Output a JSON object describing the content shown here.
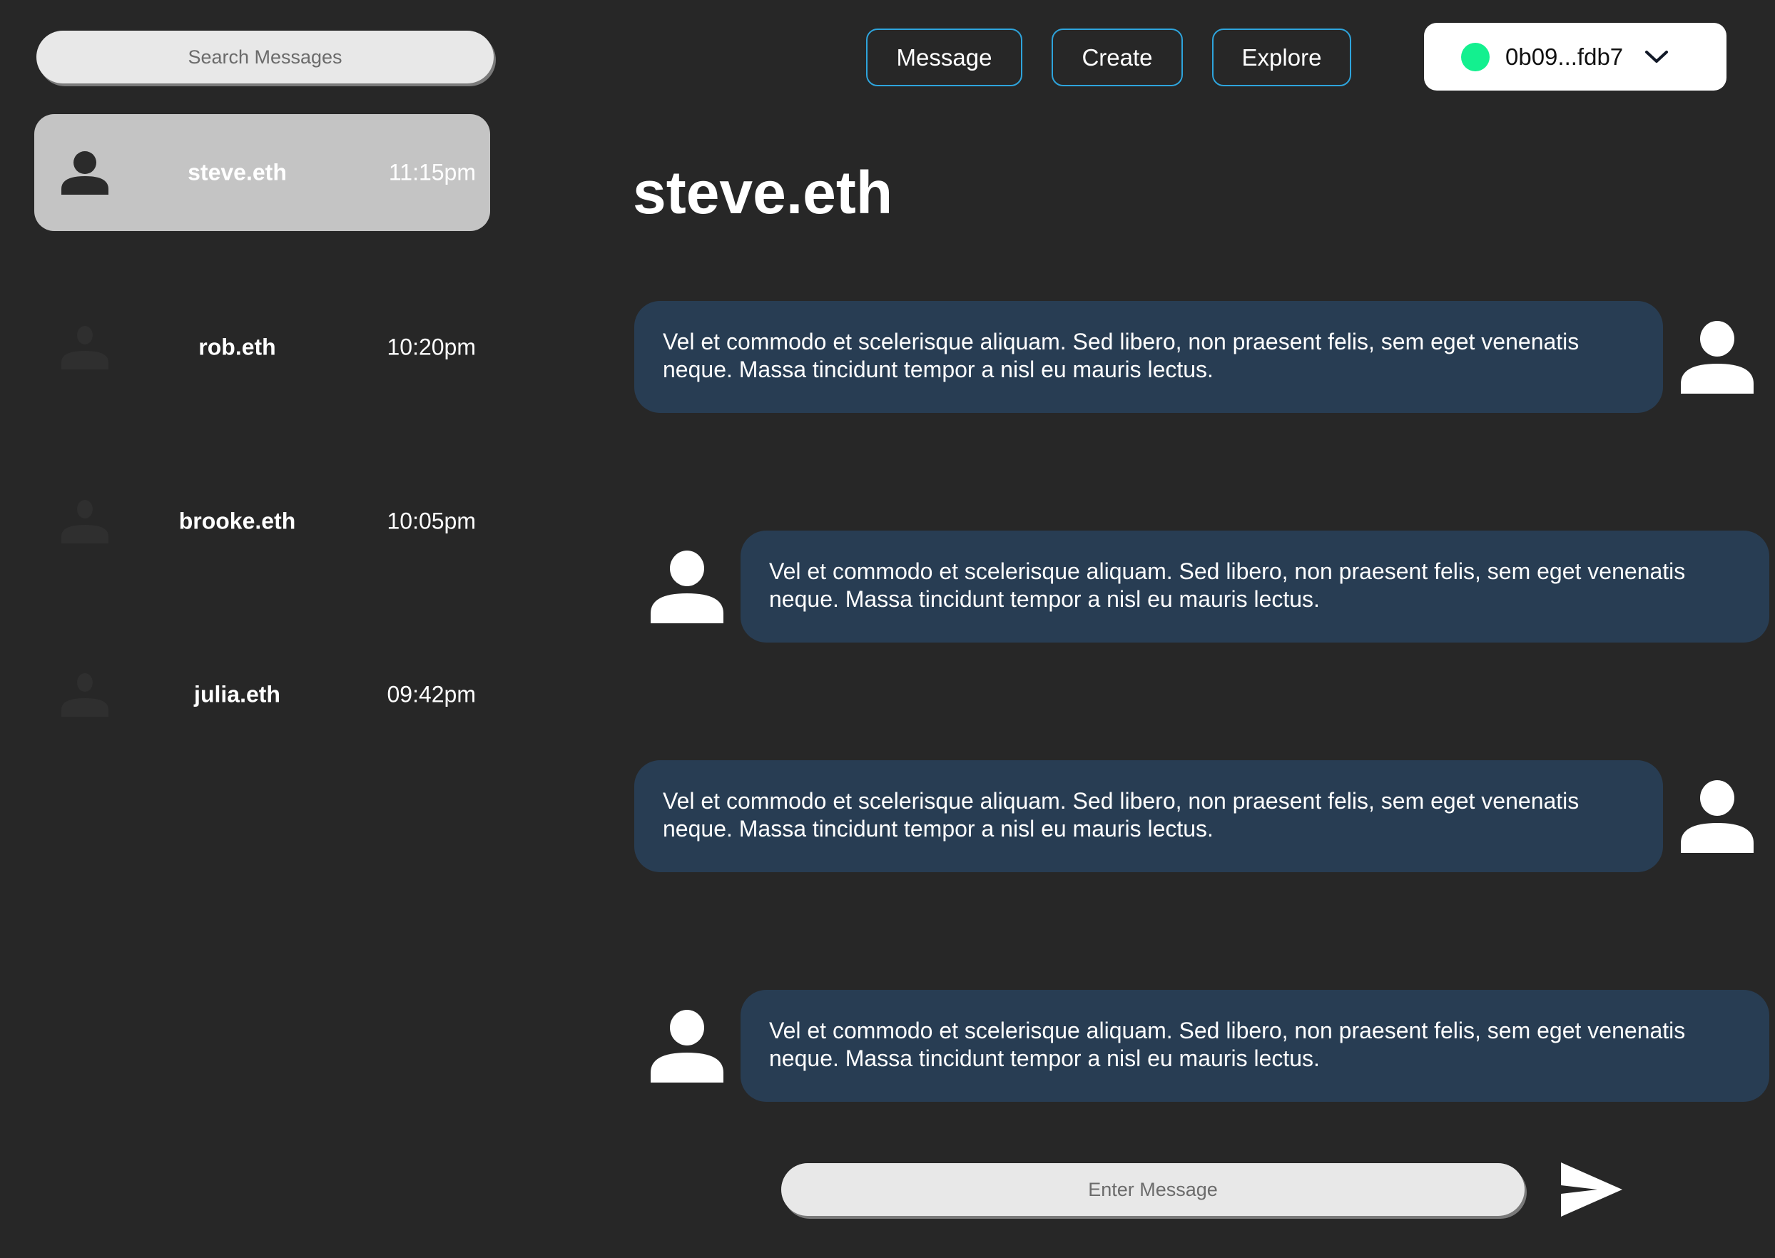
{
  "search": {
    "placeholder": "Search Messages",
    "value": ""
  },
  "contacts": [
    {
      "name": "steve.eth",
      "time": "11:15pm",
      "active": true
    },
    {
      "name": "rob.eth",
      "time": "10:20pm",
      "active": false
    },
    {
      "name": "brooke.eth",
      "time": "10:05pm",
      "active": false
    },
    {
      "name": "julia.eth",
      "time": "09:42pm",
      "active": false
    }
  ],
  "nav": {
    "message_label": "Message",
    "create_label": "Create",
    "explore_label": "Explore"
  },
  "wallet": {
    "address": "0b09...fdb7",
    "status_color": "#13f08f",
    "icon": "chevron-down-icon"
  },
  "chat": {
    "title": "steve.eth",
    "messages": [
      {
        "side": "sent",
        "text": "Vel et commodo et scelerisque aliquam. Sed libero, non praesent felis, sem eget venenatis neque. Massa tincidunt tempor a nisl eu mauris lectus."
      },
      {
        "side": "received",
        "text": "Vel et commodo et scelerisque aliquam. Sed libero, non praesent felis, sem eget venenatis neque. Massa tincidunt tempor a nisl eu mauris lectus."
      },
      {
        "side": "sent",
        "text": "Vel et commodo et scelerisque aliquam. Sed libero, non praesent felis, sem eget venenatis neque. Massa tincidunt tempor a nisl eu mauris lectus."
      },
      {
        "side": "received",
        "text": "Vel et commodo et scelerisque aliquam. Sed libero, non praesent felis, sem eget venenatis neque. Massa tincidunt tempor a nisl eu mauris lectus."
      }
    ]
  },
  "composer": {
    "placeholder": "Enter Message",
    "value": "",
    "send_icon": "send-icon"
  },
  "colors": {
    "background": "#272727",
    "accent_border": "#2ea4dc",
    "bubble": "#283d53",
    "active_contact": "#c4c4c4"
  }
}
